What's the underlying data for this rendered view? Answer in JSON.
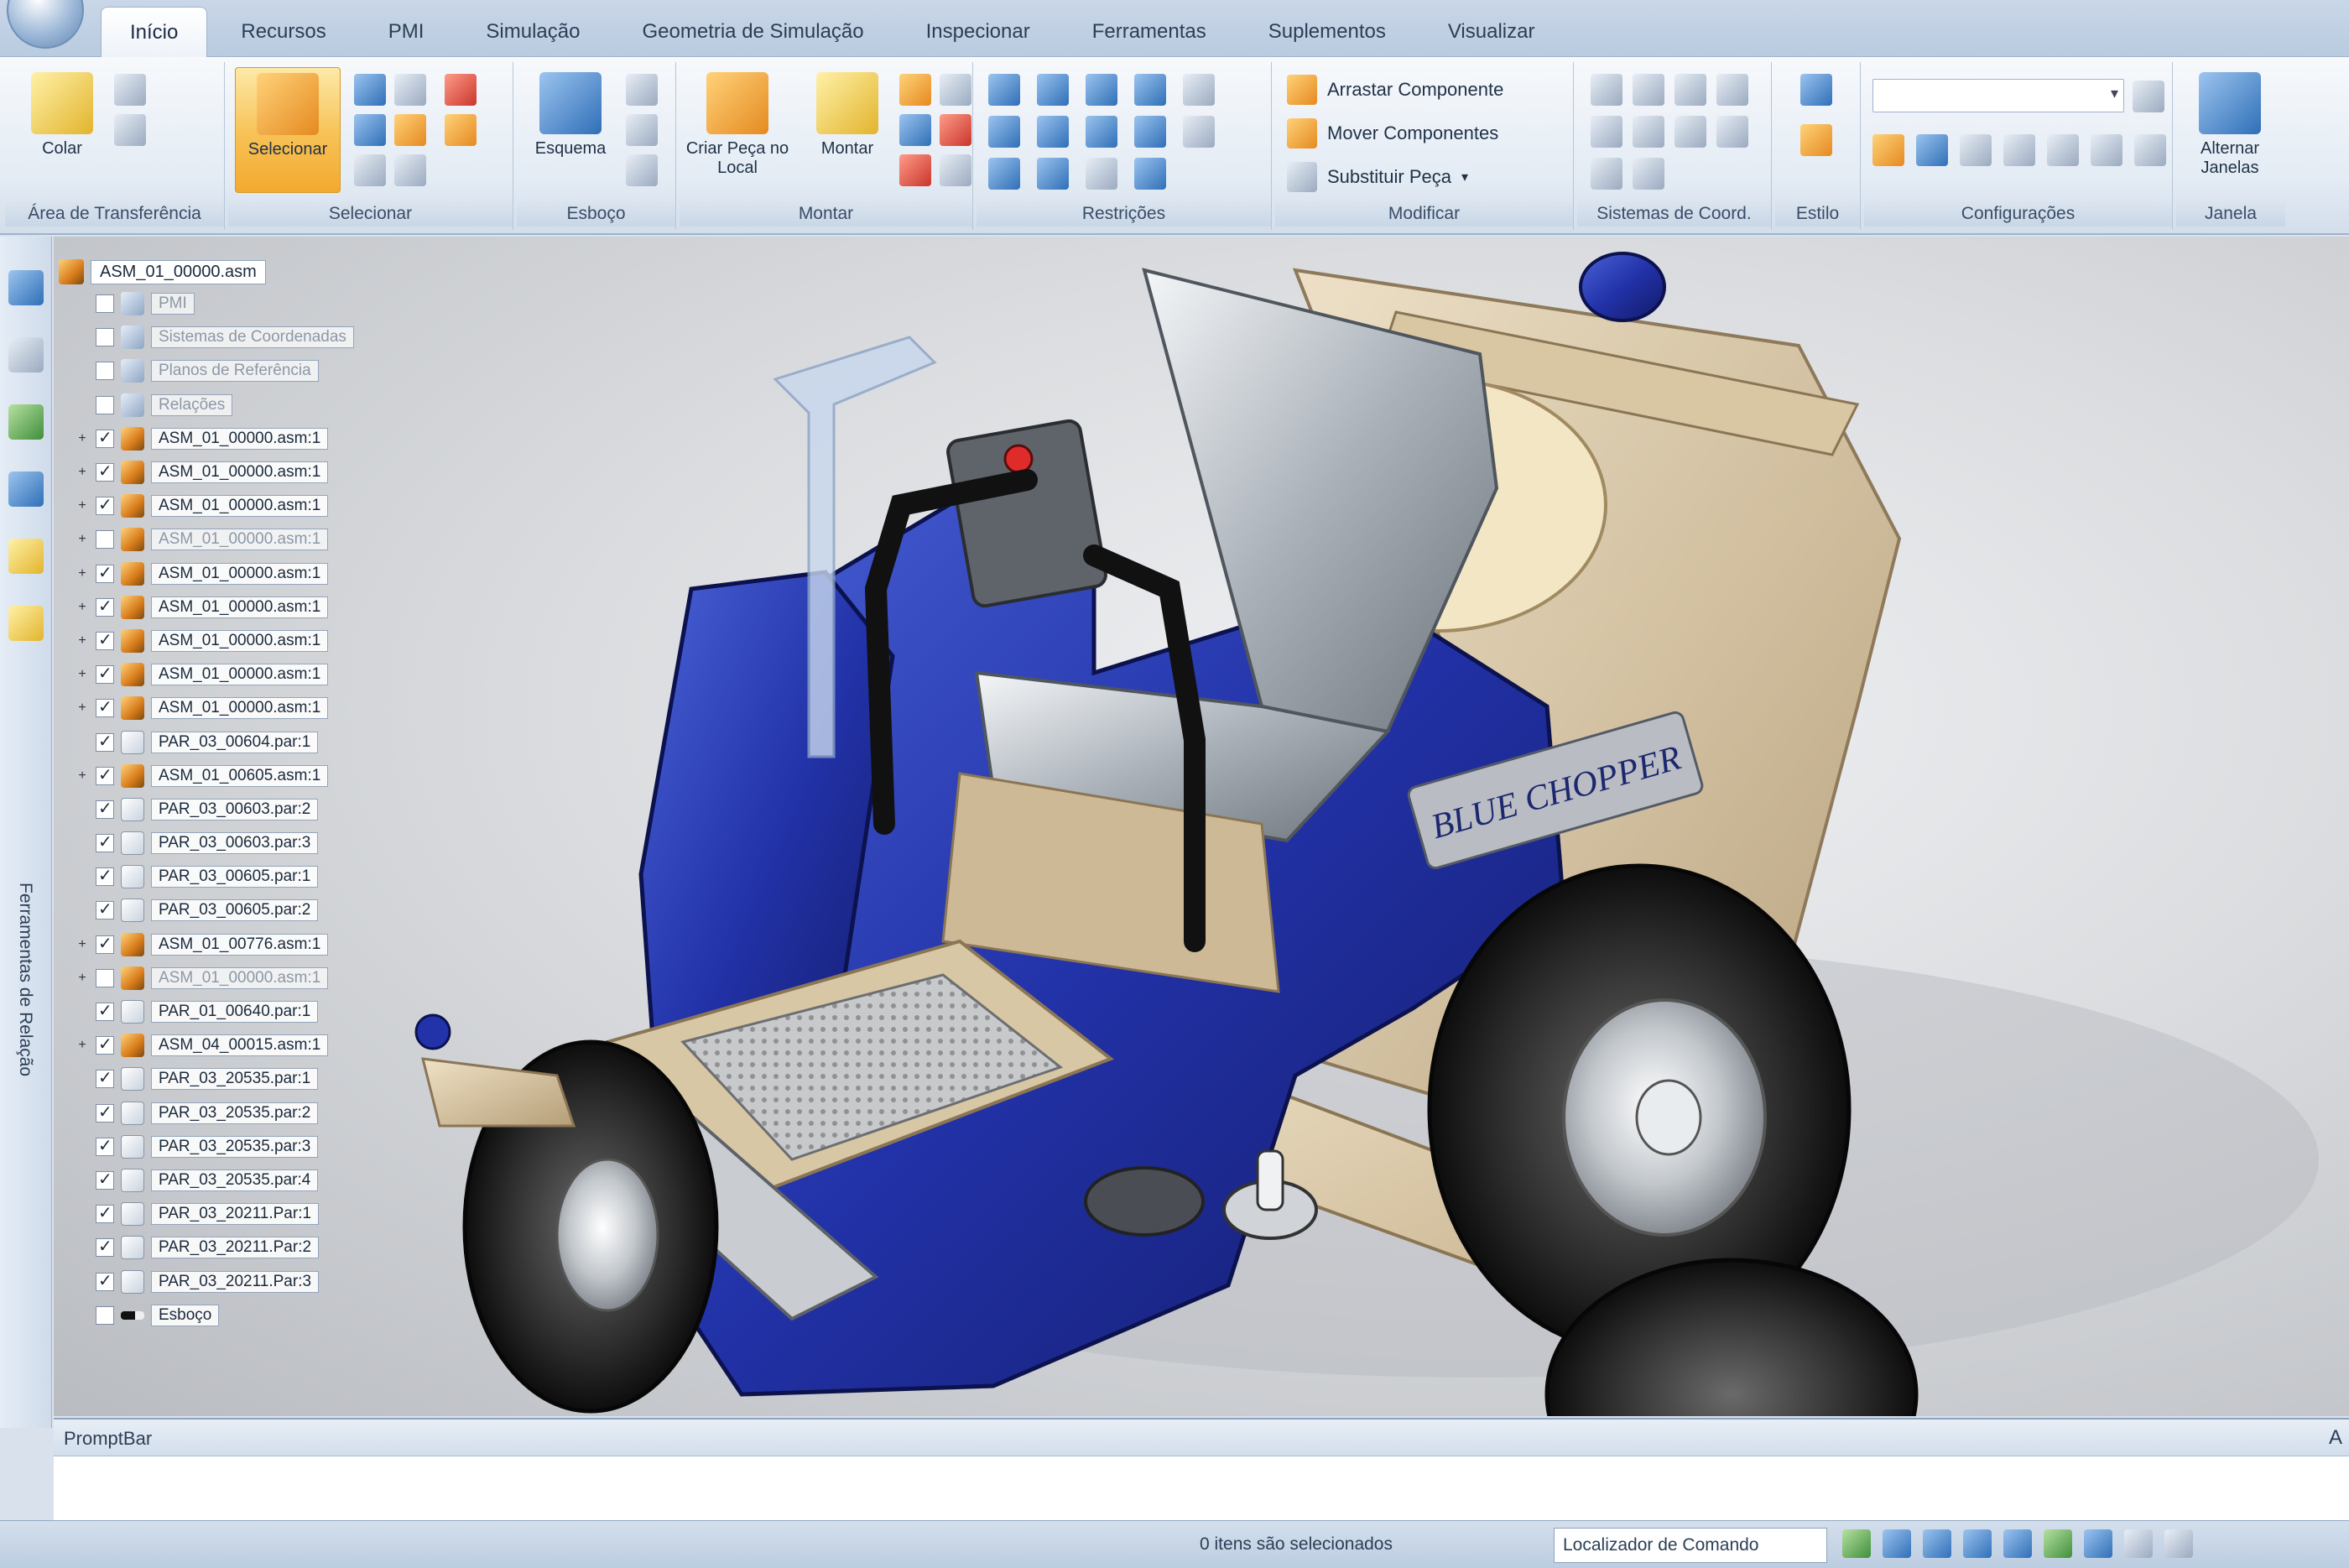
{
  "tabs": [
    "Início",
    "Recursos",
    "PMI",
    "Simulação",
    "Geometria de Simulação",
    "Inspecionar",
    "Ferramentas",
    "Suplementos",
    "Visualizar"
  ],
  "active_tab": 0,
  "ribbon": {
    "groups": [
      {
        "name": "clipboard",
        "label": "Área de Transferência"
      },
      {
        "name": "select",
        "label": "Selecionar"
      },
      {
        "name": "sketch",
        "label": "Esboço"
      },
      {
        "name": "forms",
        "label": "Montar"
      },
      {
        "name": "relations",
        "label": "Restrições"
      },
      {
        "name": "modify",
        "label": "Modificar"
      },
      {
        "name": "reference-frames",
        "label": "Sistemas de Coord."
      },
      {
        "name": "styles",
        "label": "Estilo"
      },
      {
        "name": "configurations",
        "label": "Configurações"
      },
      {
        "name": "window",
        "label": "Janela"
      }
    ],
    "paste_label": "Colar",
    "select_label": "Selecionar",
    "sketch_label": "Esquema",
    "create_part_label": "Criar Peça no Local",
    "rotate_label": "Montar",
    "modify_items": [
      "Arrastar Componente",
      "Mover Componentes",
      "Substituir Peça"
    ],
    "window_label": "Alternar Janelas"
  },
  "tree": {
    "root": "ASM_01_00000.asm",
    "items": [
      {
        "label": "PMI",
        "checked": false,
        "icon": "sys",
        "dim": true
      },
      {
        "label": "Sistemas de Coordenadas",
        "checked": false,
        "icon": "sys",
        "dim": true
      },
      {
        "label": "Planos de Referência",
        "checked": false,
        "icon": "sys",
        "dim": true
      },
      {
        "label": "Relações",
        "checked": false,
        "icon": "sys",
        "dim": true
      },
      {
        "label": "ASM_01_00000.asm:1",
        "checked": true,
        "icon": "asm",
        "dim": false
      },
      {
        "label": "ASM_01_00000.asm:1",
        "checked": true,
        "icon": "asm",
        "dim": false
      },
      {
        "label": "ASM_01_00000.asm:1",
        "checked": true,
        "icon": "asm",
        "dim": false
      },
      {
        "label": "ASM_01_00000.asm:1",
        "checked": false,
        "icon": "asm",
        "dim": true
      },
      {
        "label": "ASM_01_00000.asm:1",
        "checked": true,
        "icon": "asm",
        "dim": false
      },
      {
        "label": "ASM_01_00000.asm:1",
        "checked": true,
        "icon": "asm",
        "dim": false
      },
      {
        "label": "ASM_01_00000.asm:1",
        "checked": true,
        "icon": "asm",
        "dim": false
      },
      {
        "label": "ASM_01_00000.asm:1",
        "checked": true,
        "icon": "asm",
        "dim": false
      },
      {
        "label": "ASM_01_00000.asm:1",
        "checked": true,
        "icon": "asm",
        "dim": false
      },
      {
        "label": "PAR_03_00604.par:1",
        "checked": true,
        "icon": "par",
        "dim": false
      },
      {
        "label": "ASM_01_00605.asm:1",
        "checked": true,
        "icon": "asm",
        "dim": false
      },
      {
        "label": "PAR_03_00603.par:2",
        "checked": true,
        "icon": "par",
        "dim": false
      },
      {
        "label": "PAR_03_00603.par:3",
        "checked": true,
        "icon": "par",
        "dim": false
      },
      {
        "label": "PAR_03_00605.par:1",
        "checked": true,
        "icon": "par",
        "dim": false
      },
      {
        "label": "PAR_03_00605.par:2",
        "checked": true,
        "icon": "par",
        "dim": false
      },
      {
        "label": "ASM_01_00776.asm:1",
        "checked": true,
        "icon": "asm",
        "dim": false
      },
      {
        "label": "ASM_01_00000.asm:1",
        "checked": false,
        "icon": "asm",
        "dim": true
      },
      {
        "label": "PAR_01_00640.par:1",
        "checked": true,
        "icon": "par",
        "dim": false
      },
      {
        "label": "ASM_04_00015.asm:1",
        "checked": true,
        "icon": "asm",
        "dim": false
      },
      {
        "label": "PAR_03_20535.par:1",
        "checked": true,
        "icon": "par",
        "dim": false
      },
      {
        "label": "PAR_03_20535.par:2",
        "checked": true,
        "icon": "par",
        "dim": false
      },
      {
        "label": "PAR_03_20535.par:3",
        "checked": true,
        "icon": "par",
        "dim": false
      },
      {
        "label": "PAR_03_20535.par:4",
        "checked": true,
        "icon": "par",
        "dim": false
      },
      {
        "label": "PAR_03_20211.Par:1",
        "checked": true,
        "icon": "par",
        "dim": false
      },
      {
        "label": "PAR_03_20211.Par:2",
        "checked": true,
        "icon": "par",
        "dim": false
      },
      {
        "label": "PAR_03_20211.Par:3",
        "checked": true,
        "icon": "par",
        "dim": false
      },
      {
        "label": "Esboço",
        "checked": false,
        "icon": "sketch",
        "dim": false
      }
    ]
  },
  "left_panel_vertical_label": "Ferramentas de Relação",
  "model_decal_text": "BLUE CHOPPER",
  "prompt": {
    "label": "PromptBar",
    "pin": "A"
  },
  "status": {
    "selection_text": "0 itens são selecionados",
    "command_finder": "Localizador de Comando"
  },
  "colors": {
    "accent_orange": "#f3a930",
    "chassis_blue": "#1f2fa8",
    "frame_tan": "#c9b18a",
    "ribbon_bg": "#e3ebf4"
  }
}
